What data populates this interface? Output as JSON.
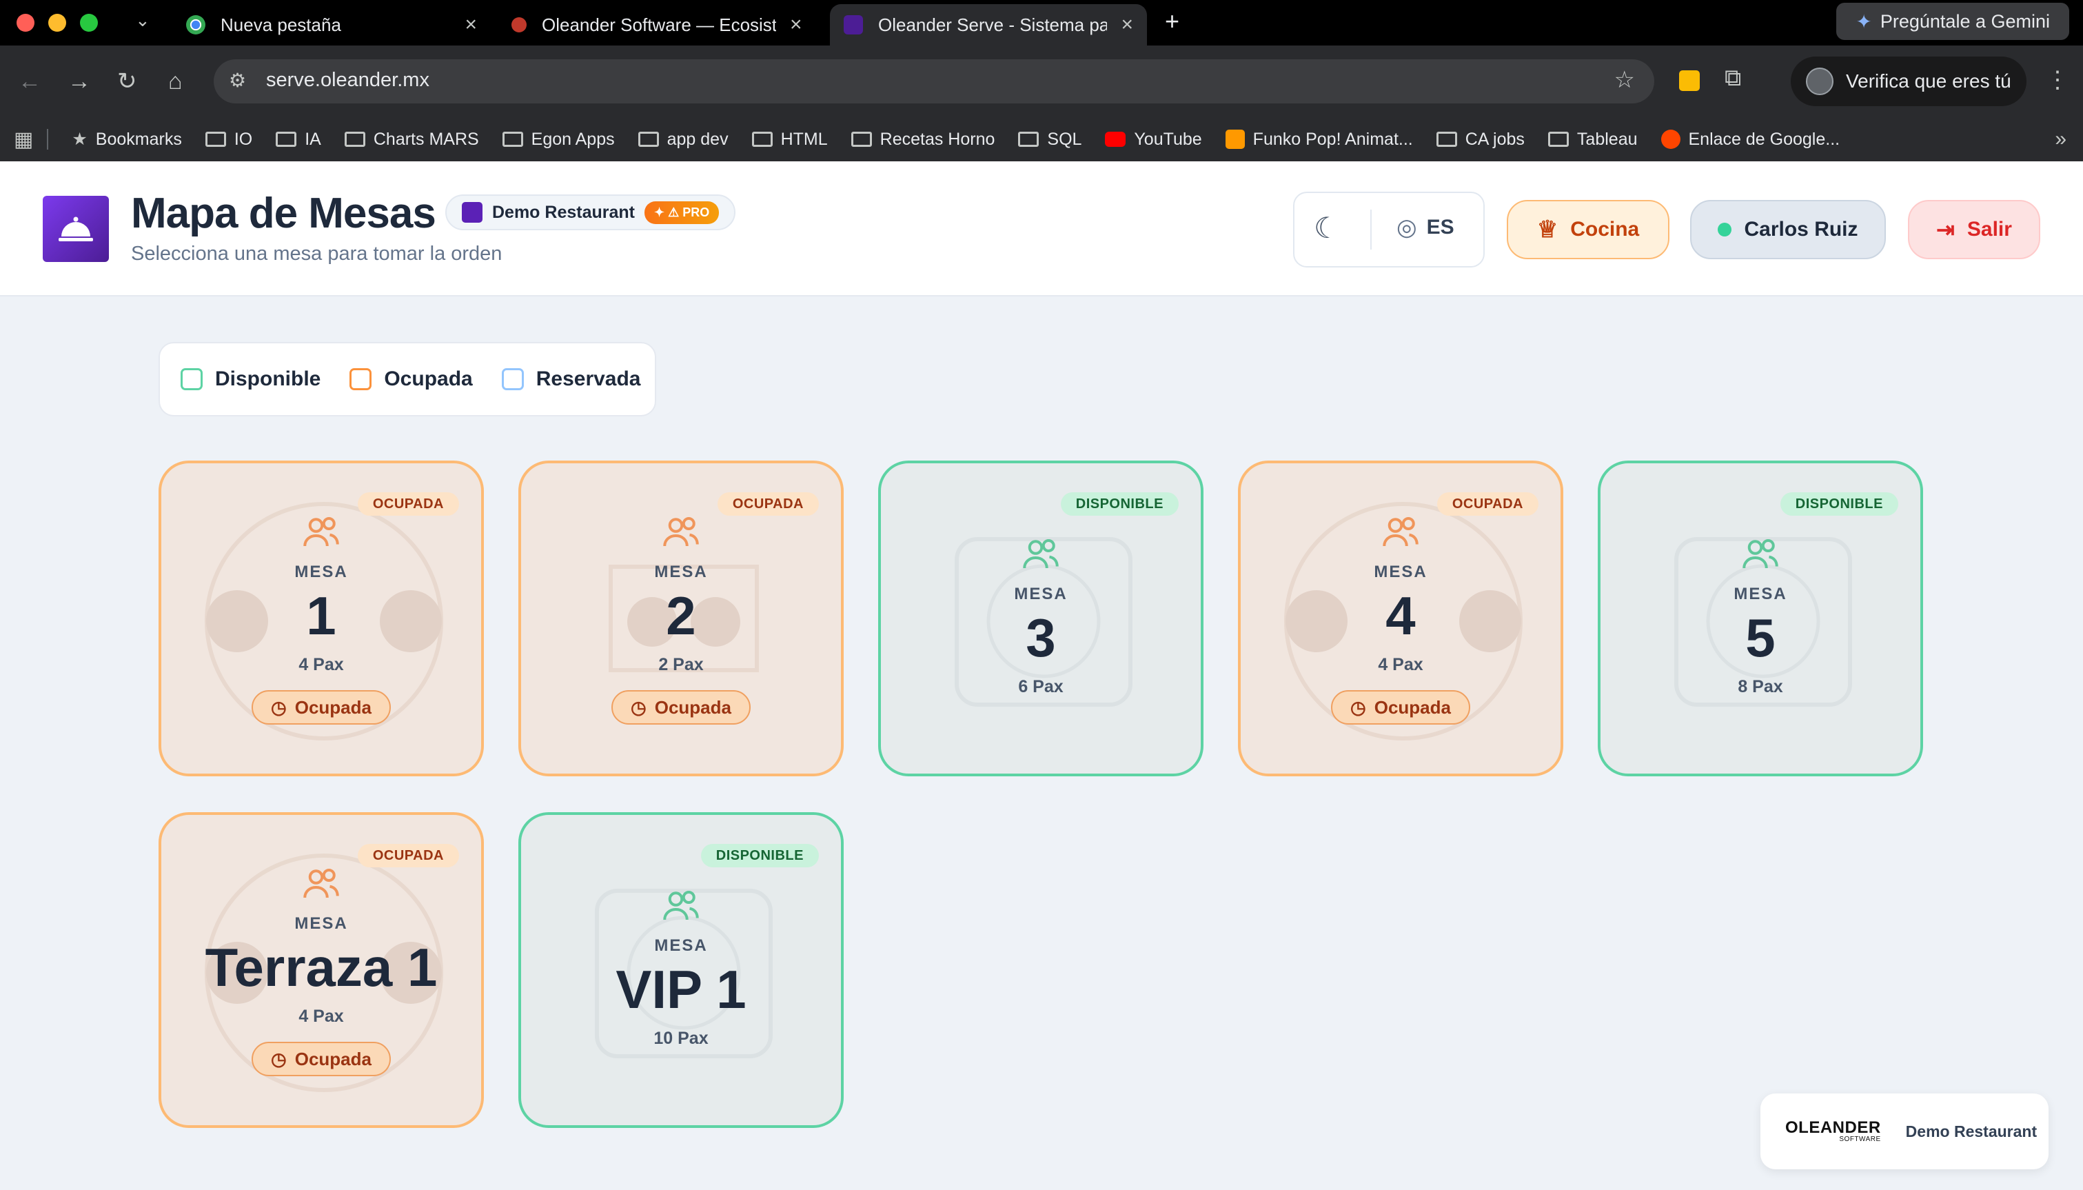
{
  "browser": {
    "tabs": [
      {
        "title": "Nueva pestaña"
      },
      {
        "title": "Oleander Software — Ecosistema"
      },
      {
        "title": "Oleander Serve - Sistema para"
      }
    ],
    "gemini_label": "Pregúntale a Gemini",
    "url": "serve.oleander.mx",
    "verify_label": "Verifica que eres tú",
    "bookmarks": [
      "Bookmarks",
      "IO",
      "IA",
      "Charts MARS",
      "Egon Apps",
      "app dev",
      "HTML",
      "Recetas Horno",
      "SQL",
      "YouTube",
      "Funko Pop! Animat...",
      "CA jobs",
      "Tableau",
      "Enlace de Google..."
    ]
  },
  "header": {
    "title": "Mapa de Mesas",
    "subtitle": "Selecciona una mesa para tomar la orden",
    "restaurant": "Demo Restaurant",
    "pro_badge": "PRO",
    "language": "ES",
    "kitchen_label": "Cocina",
    "user_name": "Carlos Ruiz",
    "logout_label": "Salir"
  },
  "legend": {
    "available": "Disponible",
    "occupied": "Ocupada",
    "reserved": "Reservada"
  },
  "tables": [
    {
      "label": "MESA",
      "name": "1",
      "pax": "4 Pax",
      "badge": "OCUPADA",
      "status": "Ocupada"
    },
    {
      "label": "MESA",
      "name": "2",
      "pax": "2 Pax",
      "badge": "OCUPADA",
      "status": "Ocupada"
    },
    {
      "label": "MESA",
      "name": "3",
      "pax": "6 Pax",
      "badge": "DISPONIBLE"
    },
    {
      "label": "MESA",
      "name": "4",
      "pax": "4 Pax",
      "badge": "OCUPADA",
      "status": "Ocupada"
    },
    {
      "label": "MESA",
      "name": "5",
      "pax": "8 Pax",
      "badge": "DISPONIBLE"
    },
    {
      "label": "MESA",
      "name": "Terraza 1",
      "pax": "4 Pax",
      "badge": "OCUPADA",
      "status": "Ocupada"
    },
    {
      "label": "MESA",
      "name": "VIP 1",
      "pax": "10 Pax",
      "badge": "DISPONIBLE"
    }
  ],
  "footer": {
    "brand": "OLEANDER",
    "brand_sub": "SOFTWARE",
    "restaurant": "Demo Restaurant"
  },
  "colors": {
    "occupied": "#fdba74",
    "available": "#5dd3a4",
    "reserved": "#93c5fd",
    "brand": "#7c3aed"
  }
}
